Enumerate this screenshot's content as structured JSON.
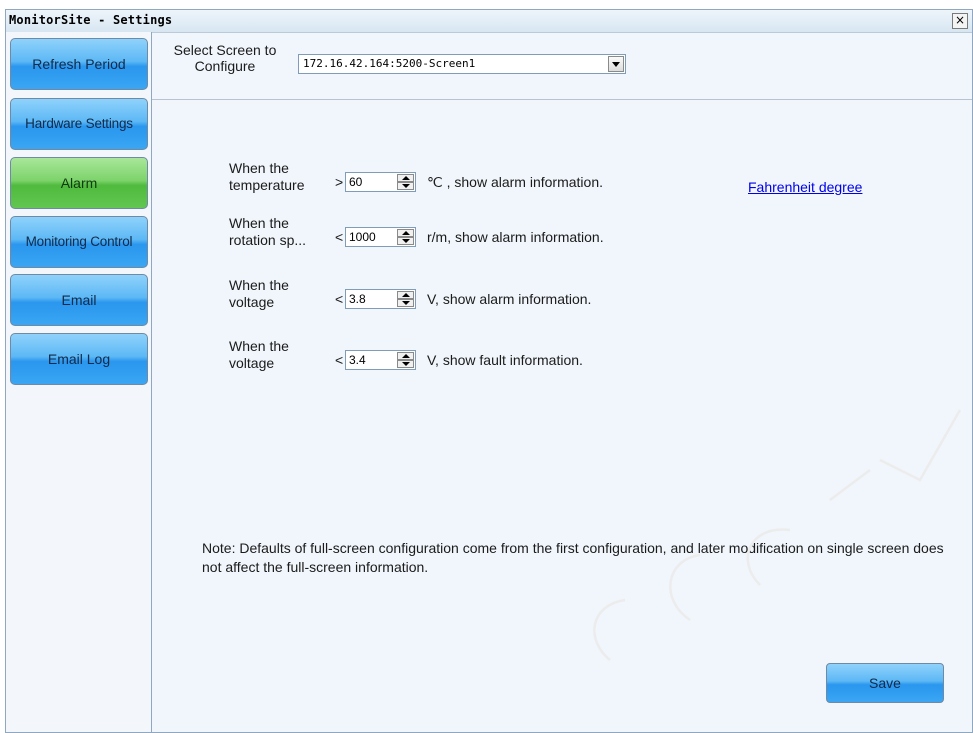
{
  "window": {
    "title": "MonitorSite - Settings",
    "close_symbol": "×"
  },
  "sidebar": {
    "items": [
      {
        "label": "Refresh Period",
        "active": false
      },
      {
        "label": "Hardware Settings",
        "active": false
      },
      {
        "label": "Alarm",
        "active": true
      },
      {
        "label": "Monitoring Control",
        "active": false
      },
      {
        "label": "Email",
        "active": false
      },
      {
        "label": "Email Log",
        "active": false
      }
    ]
  },
  "screen_select": {
    "label": "Select Screen to Configure",
    "value": "172.16.42.164:5200-Screen1"
  },
  "rules": [
    {
      "label": "When the temperature",
      "operator": ">",
      "value": "60",
      "suffix": "℃ , show alarm information."
    },
    {
      "label": "When the rotation sp...",
      "operator": "<",
      "value": "1000",
      "suffix": "r/m, show alarm information."
    },
    {
      "label": "When the voltage",
      "operator": "<",
      "value": "3.8",
      "suffix": "V, show alarm information."
    },
    {
      "label": "When the voltage",
      "operator": "<",
      "value": "3.4",
      "suffix": "V, show fault information."
    }
  ],
  "fahrenheit_link": "Fahrenheit degree",
  "note": "Note: Defaults of full-screen configuration come from the first configuration, and later modification on single screen does not affect the full-screen information.",
  "save_label": "Save",
  "colors": {
    "nav_blue": "#3aa6f3",
    "nav_active_green": "#62c651",
    "link": "#0000ee"
  }
}
